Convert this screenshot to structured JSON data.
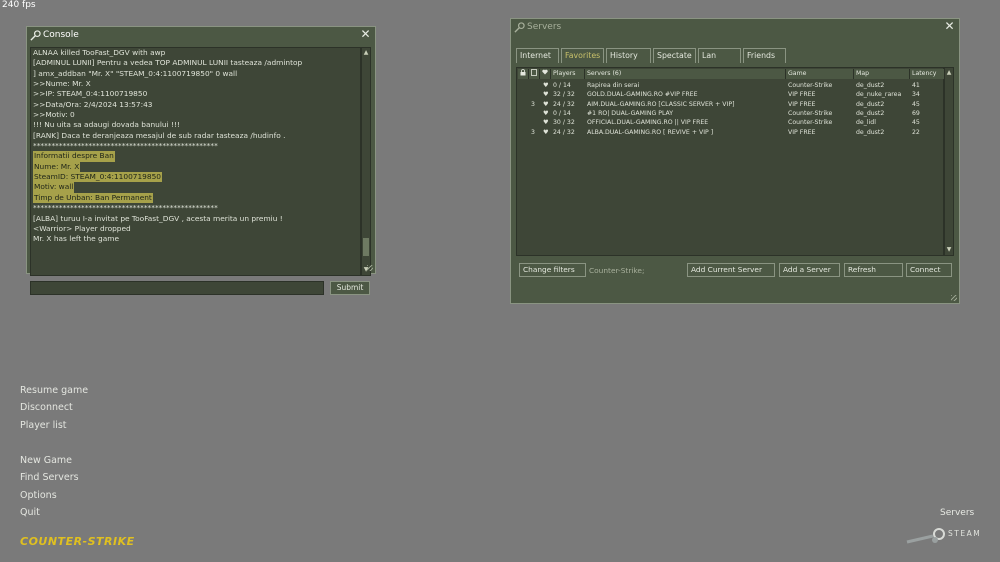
{
  "fps": "240 fps",
  "console": {
    "title": "Console",
    "lines": [
      {
        "text": "ALNAA killed TooFast_DGV with awp",
        "hl": false
      },
      {
        "text": "[ADMINUL LUNII] Pentru a vedea TOP ADMINUL LUNII tasteaza /admintop",
        "hl": false
      },
      {
        "text": "] amx_addban \"Mr. X\" \"STEAM_0:4:1100719850\" 0 wall",
        "hl": false
      },
      {
        "text": ">>Nume: Mr. X",
        "hl": false
      },
      {
        "text": ">>IP: STEAM_0:4:1100719850",
        "hl": false
      },
      {
        "text": ">>Data/Ora: 2/4/2024 13:57:43",
        "hl": false
      },
      {
        "text": ">>Motiv: 0",
        "hl": false
      },
      {
        "text": "!!! Nu uita sa adaugi dovada banului !!!",
        "hl": false
      },
      {
        "text": "[RANK] Daca te deranjeaza mesajul de sub radar tasteaza /hudinfo .",
        "hl": false
      },
      {
        "text": "**************************************************",
        "hl": false
      },
      {
        "text": "Informatii despre Ban",
        "hl": true
      },
      {
        "text": "Nume: Mr. X",
        "hl": true
      },
      {
        "text": "SteamID: STEAM_0:4:1100719850",
        "hl": true
      },
      {
        "text": "Motiv: wall",
        "hl": true
      },
      {
        "text": "Timp de Unban: Ban Permanent",
        "hl": true
      },
      {
        "text": "**************************************************",
        "hl": false
      },
      {
        "text": "[ALBA] turuu I-a invitat pe TooFast_DGV , acesta merita un premiu !",
        "hl": false
      },
      {
        "text": " <Warrior> Player dropped",
        "hl": false
      },
      {
        "text": "Mr. X has left the game",
        "hl": false
      }
    ],
    "input_value": "",
    "submit_label": "Submit"
  },
  "servers": {
    "title": "Servers",
    "tabs": [
      "Internet",
      "Favorites",
      "History",
      "Spectate",
      "Lan",
      "Friends"
    ],
    "active_tab": "Favorites",
    "columns": {
      "lock": "",
      "vac": "",
      "fav": "",
      "players": "Players",
      "servers": "Servers (6)",
      "game": "Game",
      "map": "Map",
      "latency": "Latency"
    },
    "rows": [
      {
        "bots": "",
        "players": "0 / 14",
        "name": "Rapirea din serai",
        "game": "Counter-Strike",
        "map": "de_dust2",
        "latency": "41"
      },
      {
        "bots": "",
        "players": "32 / 32",
        "name": "GOLD.DUAL-GAMING.RO #VIP FREE",
        "game": "VIP FREE",
        "map": "de_nuke_rarea",
        "latency": "34"
      },
      {
        "bots": "3",
        "players": "24 / 32",
        "name": "AIM.DUAL-GAMING.RO [CLASSIC SERVER + VIP]",
        "game": "VIP FREE",
        "map": "de_dust2",
        "latency": "45"
      },
      {
        "bots": "",
        "players": "0 / 14",
        "name": "#1 RO| DUAL-GAMING PLAY",
        "game": "Counter-Strike",
        "map": "de_dust2",
        "latency": "69"
      },
      {
        "bots": "",
        "players": "30 / 32",
        "name": "OFFICIAL.DUAL-GAMING.RO || VIP FREE",
        "game": "Counter-Strike",
        "map": "de_lidl",
        "latency": "45"
      },
      {
        "bots": "3",
        "players": "24 / 32",
        "name": "ALBA.DUAL-GAMING.RO [ REVIVE + VIP ]",
        "game": "VIP FREE",
        "map": "de_dust2",
        "latency": "22"
      }
    ],
    "change_filters_label": "Change filters",
    "filter_text": "Counter-Strike;",
    "add_current_label": "Add Current Server",
    "add_server_label": "Add a Server",
    "refresh_label": "Refresh",
    "connect_label": "Connect"
  },
  "menu": {
    "resume": "Resume game",
    "disconnect": "Disconnect",
    "player_list": "Player list",
    "new_game": "New Game",
    "find_servers": "Find Servers",
    "options": "Options",
    "quit": "Quit"
  },
  "logo_text": "COUNTER-STRIKE",
  "bottom_right": {
    "servers_link": "Servers",
    "steam_text": "STEAM"
  },
  "colors": {
    "background": "#7a7a7a",
    "window": "#4c5844",
    "highlight": "#a6a14a",
    "logo": "#e0c020"
  }
}
